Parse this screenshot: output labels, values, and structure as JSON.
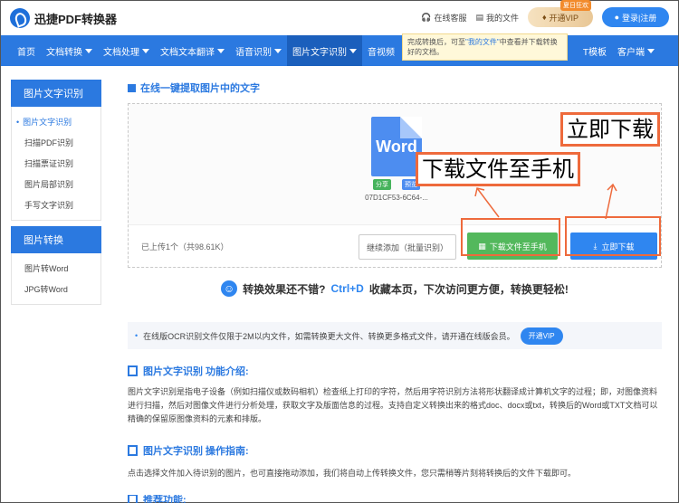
{
  "header": {
    "logo_text": "迅捷PDF转换器",
    "service_label": "在线客服",
    "my_files_label": "我的文件",
    "vip_label": "开通VIP",
    "vip_badge": "夏日狂欢",
    "login_label": "登录|注册"
  },
  "nav": {
    "items": [
      {
        "label": "首页",
        "dropdown": false
      },
      {
        "label": "文档转换",
        "dropdown": true
      },
      {
        "label": "文档处理",
        "dropdown": true
      },
      {
        "label": "文档文本翻译",
        "dropdown": true
      },
      {
        "label": "语音识别",
        "dropdown": true
      },
      {
        "label": "图片文字识别",
        "dropdown": true,
        "active": true
      },
      {
        "label": "音视频",
        "dropdown": false
      }
    ],
    "right_items": [
      {
        "label": "T模板",
        "dropdown": false
      },
      {
        "label": "客户端",
        "dropdown": true
      }
    ]
  },
  "tooltip": {
    "text_before": "完成转换后，可至",
    "highlight": "\"我的文件\"",
    "text_after": "中查看并下载转换好的文档。"
  },
  "sidebar": {
    "groups": [
      {
        "title": "图片文字识别",
        "items": [
          {
            "label": "图片文字识别",
            "active": true
          },
          {
            "label": "扫描PDF识别"
          },
          {
            "label": "扫描票证识别"
          },
          {
            "label": "图片局部识别"
          },
          {
            "label": "手写文字识别"
          }
        ]
      },
      {
        "title": "图片转换",
        "items": [
          {
            "label": "图片转Word"
          },
          {
            "label": "JPG转Word"
          }
        ]
      }
    ]
  },
  "main": {
    "section_title": "在线一键提取图片中的文字",
    "file": {
      "icon_text": "Word",
      "share_tag": "分享",
      "preview_tag": "预览",
      "name": "07D1CF53-6C64-..."
    },
    "upload_count": "已上传1个（共98.61K）",
    "continue_label": "继续添加（批量识别）",
    "download_phone_label": "下载文件至手机",
    "download_now_label": "立即下载",
    "callout_download": "立即下载",
    "callout_phone": "下载文件至手机",
    "promo": {
      "before": "转换效果还不错?",
      "shortcut": "Ctrl+D",
      "after": "收藏本页，下次访问更方便，转换更轻松!"
    },
    "notice": {
      "text": "在线版OCR识别文件仅限于2M以内文件，如需转换更大文件、转换更多格式文件，请开通在线版会员。",
      "button": "开通VIP"
    },
    "intro": {
      "title": "图片文字识别 功能介绍:",
      "body": "图片文字识别是指电子设备（例如扫描仪或数码相机）检查纸上打印的字符，然后用字符识别方法将形状翻译成计算机文字的过程；即，对图像资料进行扫描，然后对图像文件进行分析处理，获取文字及版面信息的过程。支持自定义转换出来的格式doc、docx或txt，转换后的Word或TXT文档可以精确的保留原图像资料的元素和排版。"
    },
    "guide": {
      "title": "图片文字识别 操作指南:",
      "body": "点击选择文件加入待识别的图片，也可直接拖动添加，我们将自动上传转换文件，您只需稍等片刻将转换后的文件下载即可。"
    },
    "recommend_title": "推荐功能:"
  },
  "colors": {
    "brand_blue": "#2b79e0",
    "green": "#53b85c",
    "annotation_orange": "#ee6a3c"
  }
}
